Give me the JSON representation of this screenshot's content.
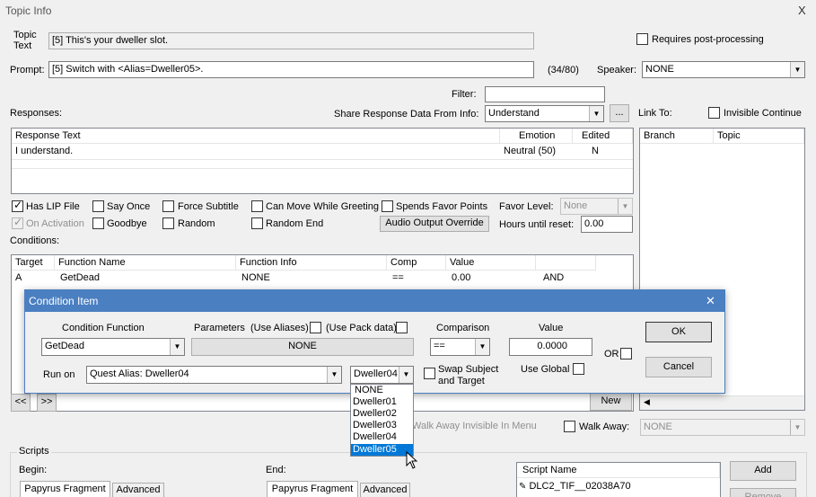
{
  "window": {
    "title": "Topic Info",
    "close": "X"
  },
  "topic": {
    "label_1": "Topic",
    "label_2": "Text",
    "value": "[5] This's your dweller slot."
  },
  "requires_post": "Requires post-processing",
  "prompt": {
    "label": "Prompt:",
    "value": "[5] Switch with <Alias=Dweller05>.",
    "count": "(34/80)"
  },
  "speaker": {
    "label": "Speaker:",
    "value": "NONE"
  },
  "filter": {
    "label": "Filter:",
    "value": ""
  },
  "responses": {
    "label": "Responses:",
    "share_label": "Share Response Data From Info:",
    "share_value": "Understand",
    "ellipsis": "..."
  },
  "link": {
    "label": "Link To:",
    "invisible_continue": "Invisible Continue",
    "col_branch": "Branch",
    "col_topic": "Topic"
  },
  "response_table": {
    "headers": [
      "Response Text",
      "Emotion",
      "Edited"
    ],
    "rows": [
      {
        "text": "I understand.",
        "emotion": "Neutral (50)",
        "edited": "N"
      }
    ]
  },
  "options": {
    "has_lip": "Has LIP File",
    "say_once": "Say Once",
    "force_subtitle": "Force Subtitle",
    "can_move": "Can Move While Greeting",
    "spends_favor": "Spends Favor Points",
    "favor_level_label": "Favor Level:",
    "favor_level_value": "None",
    "on_activation": "On Activation",
    "goodbye": "Goodbye",
    "random": "Random",
    "random_end": "Random End",
    "audio_override": "Audio Output Override",
    "hours_label": "Hours until reset:",
    "hours_value": "0.00"
  },
  "conditions": {
    "label": "Conditions:",
    "headers": [
      "Target",
      "Function Name",
      "Function Info",
      "Comp",
      "Value"
    ],
    "rows": [
      {
        "target": "A",
        "function": "GetDead",
        "info": "NONE",
        "comp": "==",
        "value": "0.00",
        "and": "AND"
      }
    ]
  },
  "nav": {
    "prev": "<<",
    "next": ">>",
    "new": "New"
  },
  "walk": {
    "invisible_text": "Walk Away Invisible In Menu",
    "label": "Walk Away:",
    "value": "NONE"
  },
  "scripts": {
    "label": "Scripts",
    "begin": "Begin:",
    "end": "End:",
    "tab_papyrus": "Papyrus Fragment",
    "tab_advanced": "Advanced",
    "col_script_name": "Script Name",
    "script_item": "DLC2_TIF__02038A70",
    "add": "Add",
    "remove": "Remove"
  },
  "dialog": {
    "title": "Condition Item",
    "close": "✕",
    "condition_function_label": "Condition Function",
    "condition_function_value": "GetDead",
    "parameters_label": "Parameters",
    "use_aliases": "(Use Aliases)",
    "use_pack": "(Use Pack data)",
    "param_value": "NONE",
    "comparison_label": "Comparison",
    "comparison_value": "==",
    "value_label": "Value",
    "value_value": "0.0000",
    "or_label": "OR",
    "run_on_label": "Run on",
    "run_on_value": "Quest Alias: Dweller04",
    "alias_value": "Dweller04",
    "swap_1": "Swap Subject",
    "swap_2": "and Target",
    "use_global": "Use Global",
    "ok": "OK",
    "cancel": "Cancel",
    "dropdown_options": [
      "NONE",
      "Dweller01",
      "Dweller02",
      "Dweller03",
      "Dweller04",
      "Dweller05"
    ],
    "selected_option": "Dweller05"
  },
  "colors": {
    "accent": "#0078d7",
    "dialog_title": "#4a7fc1",
    "selection": "#0078d7"
  }
}
